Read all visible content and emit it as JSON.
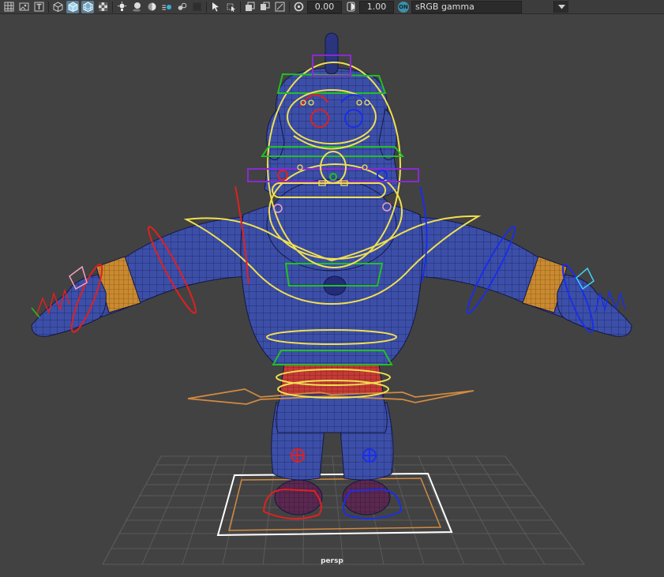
{
  "toolbar": {
    "exposure_value": "0.00",
    "gamma_value": "1.00",
    "color_space": "sRGB gamma",
    "view_transform_toggle": "ON",
    "icons": [
      "grid-icon",
      "image-plane-icon",
      "text-icon",
      "wireframe-cube-icon",
      "shaded-cube-icon",
      "wireframe-on-shaded-icon",
      "textured-icon",
      "lights-icon",
      "shadows-icon",
      "ambient-occlusion-icon",
      "motion-blur-icon",
      "anti-alias-icon",
      "xray-icon",
      "isolate-select-icon",
      "select-tool-icon",
      "panel-layout-icon",
      "camera-attributes-icon",
      "resolution-gate-icon",
      "exposure-icon",
      "gamma-icon"
    ]
  },
  "viewport": {
    "camera_name": "persp",
    "background_color": "#424242",
    "grid_color": "#5b5b5b",
    "mesh_color": "#3c4fa8",
    "wire_color": "#1b1f55",
    "cuff_color": "#c98a30",
    "belt_color": "#c53a36",
    "controls": {
      "left_side": "#e02020",
      "right_side": "#1a2ee8",
      "center": "#f0e050",
      "main": "#22c022",
      "face_box": "#8a2ad0",
      "root": "#d08a40",
      "world": "#ffffff"
    }
  }
}
